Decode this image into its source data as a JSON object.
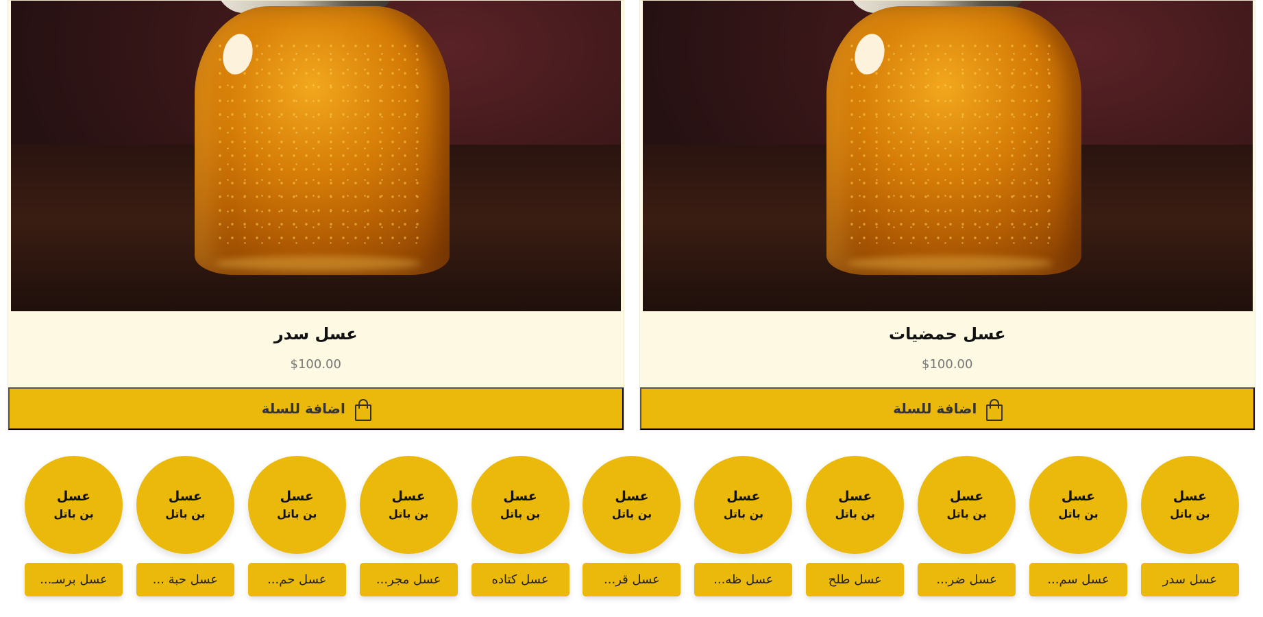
{
  "products": [
    {
      "title": "عسل حمضيات",
      "price": "$100.00",
      "button_label": "اضافة للسلة",
      "image_icon": "honey-jar-image"
    },
    {
      "title": "عسل سدر",
      "price": "$100.00",
      "button_label": "اضافة للسلة",
      "image_icon": "honey-jar-image"
    }
  ],
  "category_logo": {
    "line1": "عسل",
    "line2": "بن باتل"
  },
  "categories": [
    {
      "label": "عسل سدر"
    },
    {
      "label": "عسل سم..."
    },
    {
      "label": "عسل ضر..."
    },
    {
      "label": "عسل طلح"
    },
    {
      "label": "عسل ظه..."
    },
    {
      "label": "عسل قر..."
    },
    {
      "label": "عسل كتاده"
    },
    {
      "label": "عسل مجر..."
    },
    {
      "label": "عسل حم..."
    },
    {
      "label": "عسل حبة ..."
    },
    {
      "label": "عسل برسـ..."
    }
  ],
  "colors": {
    "accent": "#ebb80c",
    "card_background": "#fdf9e3",
    "text_dark": "#111111",
    "price_text": "#777777"
  }
}
